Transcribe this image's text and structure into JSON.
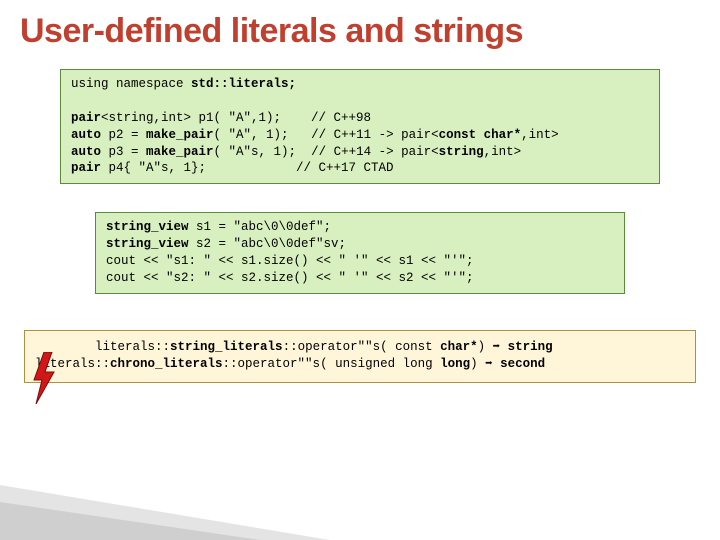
{
  "title": "User-defined literals and strings",
  "code1": {
    "l1_a": "using namespace ",
    "l1_b": "std::literals;",
    "l3_a": "pair",
    "l3_b": "<string,int> p1( \"A\",1);    // C++98",
    "l4_a": "auto",
    "l4_b": " p2 = ",
    "l4_c": "make_pair",
    "l4_d": "( \"A\", 1);   // C++11 -> pair<",
    "l4_e": "const char*",
    "l4_f": ",int>",
    "l5_a": "auto",
    "l5_b": " p3 = ",
    "l5_c": "make_pair",
    "l5_d": "( \"A\"s, 1);  // C++14 -> pair<",
    "l5_e": "string",
    "l5_f": ",int>",
    "l6_a": "pair",
    "l6_b": " p4{ \"A\"s, 1};            // C++17 CTAD"
  },
  "code2": {
    "l1_a": "string_view",
    "l1_b": " s1 = \"abc\\0\\0def\";",
    "l2_a": "string_view",
    "l2_b": " s2 = \"abc\\0\\0def\"sv;",
    "l3": "cout << \"s1: \" << s1.size() << \" '\" << s1 << \"'\";",
    "l4": "cout << \"s2: \" << s2.size() << \" '\" << s2 << \"'\";"
  },
  "code3": {
    "l1_a": "        literals::",
    "l1_b": "string_literals",
    "l1_c": "::operator\"\"s( const ",
    "l1_d": "char*",
    "l1_e": ") ➡ ",
    "l1_f": "string",
    "l2_a": "literals::",
    "l2_b": "chrono_literals",
    "l2_c": "::operator\"\"s( unsigned long ",
    "l2_d": "long",
    "l2_e": ") ➡ ",
    "l2_f": "second"
  }
}
